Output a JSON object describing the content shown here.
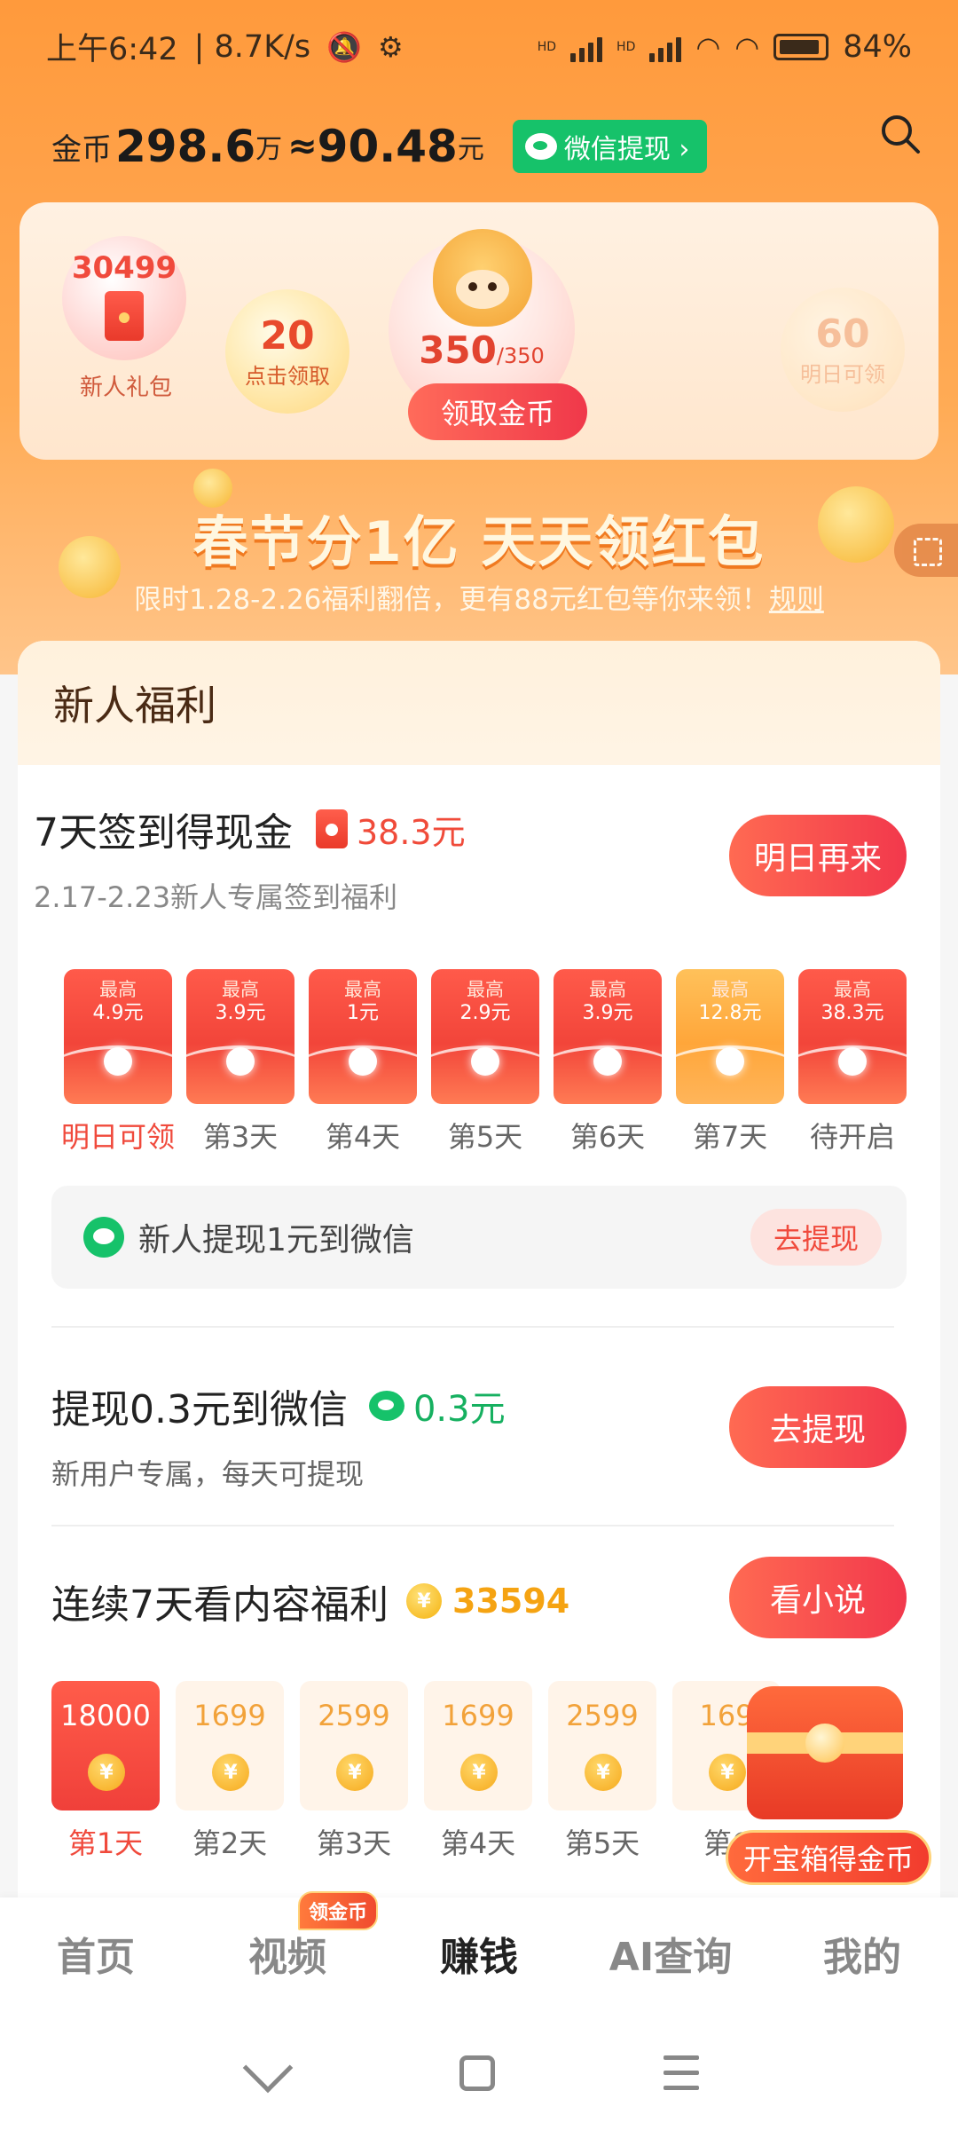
{
  "status_bar": {
    "time": "上午6:42",
    "net_speed": "| 8.7K/s",
    "sim1": "HD",
    "sim2": "HD",
    "battery": "84%"
  },
  "header": {
    "coin_label": "金币",
    "coin_value": "298.6",
    "coin_unit": "万",
    "approx": "≈",
    "cash_value": "90.48",
    "cash_unit": "元",
    "wechat_withdraw": "微信提现 ›"
  },
  "reward_card": {
    "new_gift_number": "30499",
    "new_gift_label": "新人礼包",
    "click_number": "20",
    "click_label": "点击领取",
    "main_count": "350",
    "main_total": "/350",
    "claim_button": "领取金币",
    "tomorrow_number": "60",
    "tomorrow_label": "明日可领"
  },
  "banner": {
    "title": "春节分1亿 天天领红包",
    "subtitle": "限时1.28-2.26福利翻倍，更有88元红包等你来领！",
    "rule": "规则"
  },
  "newuser": {
    "section_title": "新人福利",
    "checkin": {
      "title": "7天签到得现金",
      "amount": "38.3元",
      "subtitle": "2.17-2.23新人专属签到福利",
      "button": "明日再来",
      "days": [
        {
          "top": "最高",
          "amount": "4.9元",
          "label": "明日可领"
        },
        {
          "top": "最高",
          "amount": "3.9元",
          "label": "第3天"
        },
        {
          "top": "最高",
          "amount": "1元",
          "label": "第4天"
        },
        {
          "top": "最高",
          "amount": "2.9元",
          "label": "第5天"
        },
        {
          "top": "最高",
          "amount": "3.9元",
          "label": "第6天"
        },
        {
          "top": "最高",
          "amount": "12.8元",
          "label": "第7天"
        },
        {
          "top": "最高",
          "amount": "38.3元",
          "label": "待开启"
        }
      ]
    },
    "wechat_row": {
      "text": "新人提现1元到微信",
      "button": "去提现"
    },
    "withdraw_task": {
      "title": "提现0.3元到微信",
      "amount": "0.3元",
      "subtitle": "新用户专属，每天可提现",
      "button": "去提现"
    },
    "read_task": {
      "title": "连续7天看内容福利",
      "amount": "33594",
      "button": "看小说",
      "days": [
        {
          "value": "18000",
          "label": "第1天"
        },
        {
          "value": "1699",
          "label": "第2天"
        },
        {
          "value": "2599",
          "label": "第3天"
        },
        {
          "value": "1699",
          "label": "第4天"
        },
        {
          "value": "2599",
          "label": "第5天"
        },
        {
          "value": "169",
          "label": "第6"
        }
      ]
    },
    "chest_label": "开宝箱得金币"
  },
  "bottom_nav": {
    "items": [
      "首页",
      "视频",
      "赚钱",
      "AI查询",
      "我的"
    ],
    "badge": "领金币"
  },
  "colors": {
    "accent": "#f2384c",
    "wechat_green": "#16c26a",
    "coin_gold": "#f5a312"
  }
}
